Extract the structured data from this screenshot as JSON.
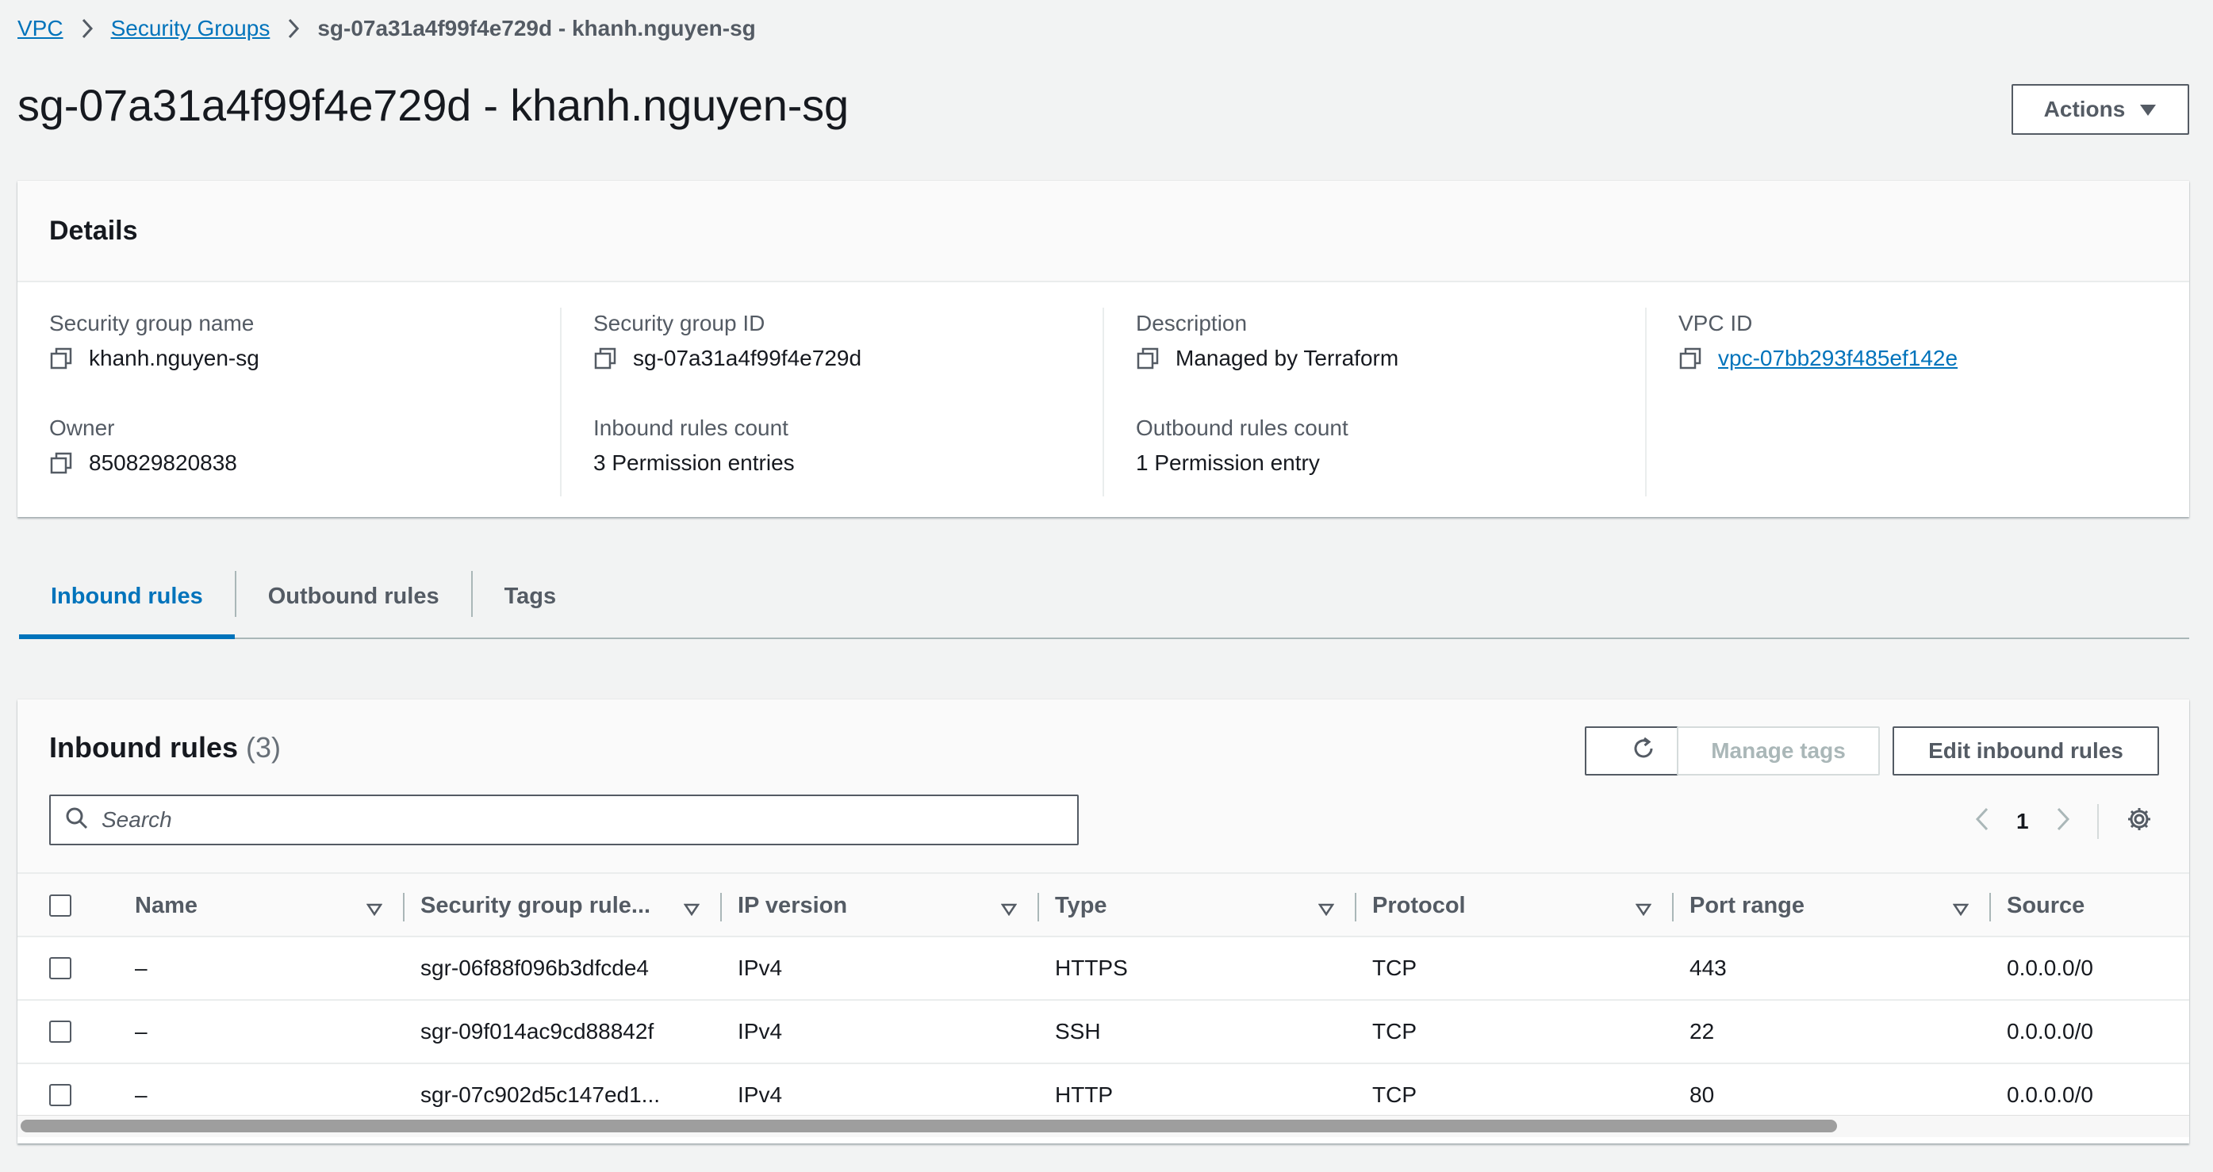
{
  "breadcrumb": {
    "items": [
      "VPC",
      "Security Groups"
    ],
    "current": "sg-07a31a4f99f4e729d - khanh.nguyen-sg"
  },
  "page": {
    "title": "sg-07a31a4f99f4e729d - khanh.nguyen-sg",
    "actions_label": "Actions"
  },
  "details": {
    "heading": "Details",
    "fields": {
      "sg_name": {
        "label": "Security group name",
        "value": "khanh.nguyen-sg"
      },
      "sg_id": {
        "label": "Security group ID",
        "value": "sg-07a31a4f99f4e729d"
      },
      "description": {
        "label": "Description",
        "value": "Managed by Terraform"
      },
      "vpc_id": {
        "label": "VPC ID",
        "value": "vpc-07bb293f485ef142e"
      },
      "owner": {
        "label": "Owner",
        "value": "850829820838"
      },
      "inbound_count": {
        "label": "Inbound rules count",
        "value": "3 Permission entries"
      },
      "outbound_count": {
        "label": "Outbound rules count",
        "value": "1 Permission entry"
      }
    }
  },
  "tabs": [
    {
      "label": "Inbound rules",
      "active": true
    },
    {
      "label": "Outbound rules",
      "active": false
    },
    {
      "label": "Tags",
      "active": false
    }
  ],
  "rules": {
    "title": "Inbound rules",
    "count": "(3)",
    "manage_tags_label": "Manage tags",
    "edit_label": "Edit inbound rules",
    "search_placeholder": "Search",
    "page_number": "1",
    "columns": [
      "Name",
      "Security group rule...",
      "IP version",
      "Type",
      "Protocol",
      "Port range",
      "Source"
    ],
    "rows": [
      {
        "name": "–",
        "rule_id": "sgr-06f88f096b3dfcde4",
        "ip_version": "IPv4",
        "type": "HTTPS",
        "protocol": "TCP",
        "port_range": "443",
        "source": "0.0.0.0/0"
      },
      {
        "name": "–",
        "rule_id": "sgr-09f014ac9cd88842f",
        "ip_version": "IPv4",
        "type": "SSH",
        "protocol": "TCP",
        "port_range": "22",
        "source": "0.0.0.0/0"
      },
      {
        "name": "–",
        "rule_id": "sgr-07c902d5c147ed1...",
        "ip_version": "IPv4",
        "type": "HTTP",
        "protocol": "TCP",
        "port_range": "80",
        "source": "0.0.0.0/0"
      }
    ]
  },
  "colors": {
    "link": "#0073bb",
    "text": "#16191f",
    "secondary_text": "#545b64",
    "background": "#f2f3f3"
  },
  "icons": [
    "chevron-right-icon",
    "caret-down-icon",
    "copy-icon",
    "refresh-icon",
    "search-icon",
    "chevron-left-icon",
    "gear-icon",
    "sort-caret-icon"
  ]
}
